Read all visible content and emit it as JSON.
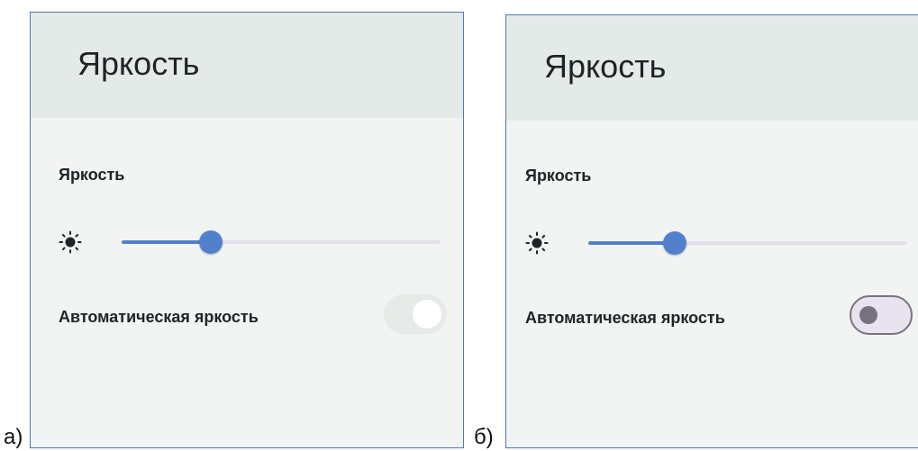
{
  "captions": {
    "a": "а)",
    "b": "б)"
  },
  "panels": [
    {
      "header_title": "Яркость",
      "section_label": "Яркость",
      "brightness": {
        "icon": "brightness-sun-icon",
        "value_fraction": 0.28
      },
      "auto_brightness": {
        "label": "Автоматическая яркость",
        "state": "on",
        "enabled": false
      }
    },
    {
      "header_title": "Яркость",
      "section_label": "Яркость",
      "brightness": {
        "icon": "brightness-sun-icon",
        "value_fraction": 0.27
      },
      "auto_brightness": {
        "label": "Автоматическая яркость",
        "state": "off",
        "enabled": true
      }
    }
  ],
  "colors": {
    "accent": "#5181cc",
    "panel_border": "#4b77c0",
    "header_bg": "#e4eae7",
    "panel_bg": "#f2f4f3"
  }
}
